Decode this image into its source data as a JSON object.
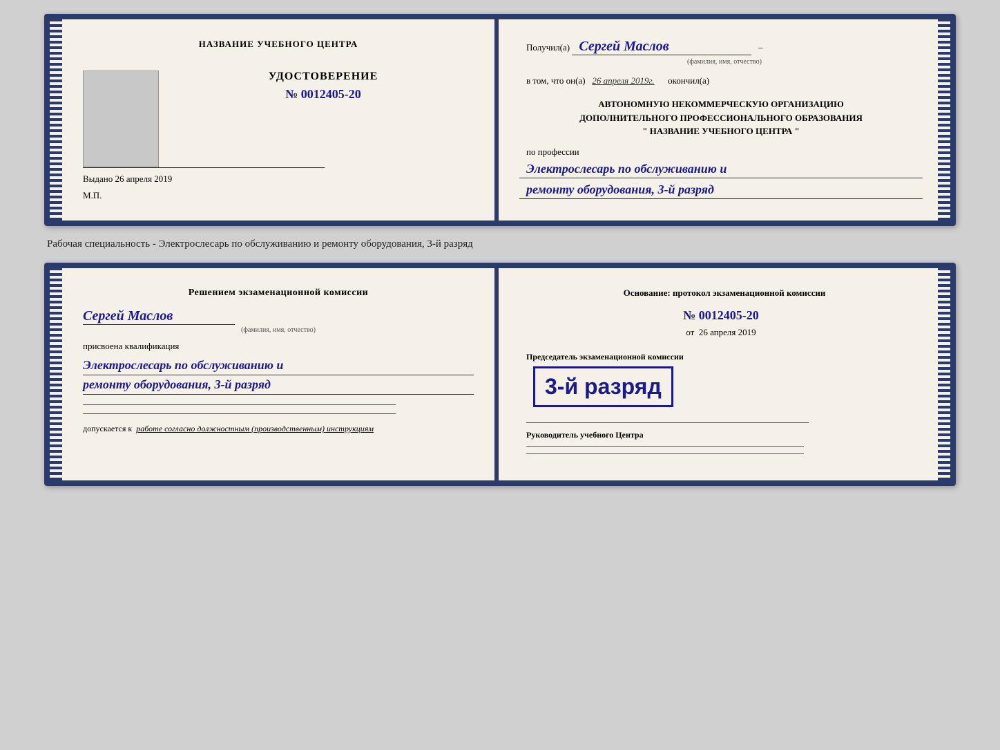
{
  "top_cert": {
    "left": {
      "heading": "НАЗВАНИЕ УЧЕБНОГО ЦЕНТРА",
      "doc_title": "УДОСТОВЕРЕНИЕ",
      "doc_number": "№ 0012405-20",
      "issued_label": "Выдано",
      "issued_date": "26 апреля 2019",
      "mp_label": "М.П."
    },
    "right": {
      "recipient_prefix": "Получил(а)",
      "recipient_name": "Сергей Маслов",
      "fio_label": "(фамилия, имя, отчество)",
      "completed_prefix": "в том, что он(а)",
      "completed_date": "26 апреля 2019г.",
      "completed_suffix": "окончил(а)",
      "org_line1": "АВТОНОМНУЮ НЕКОММЕРЧЕСКУЮ ОРГАНИЗАЦИЮ",
      "org_line2": "ДОПОЛНИТЕЛЬНОГО ПРОФЕССИОНАЛЬНОГО ОБРАЗОВАНИЯ",
      "org_line3": "\" НАЗВАНИЕ УЧЕБНОГО ЦЕНТРА \"",
      "profession_label": "по профессии",
      "profession_line1": "Электрослесарь по обслуживанию и",
      "profession_line2": "ремонту оборудования, 3-й разряд"
    }
  },
  "between_label": "Рабочая специальность - Электрослесарь по обслуживанию и ремонту оборудования, 3-й разряд",
  "bottom_cert": {
    "left": {
      "decision_title": "Решением экзаменационной комиссии",
      "person_name": "Сергей Маслов",
      "fio_label": "(фамилия, имя, отчество)",
      "qualification_label": "присвоена квалификация",
      "qual_line1": "Электрослесарь по обслуживанию и",
      "qual_line2": "ремонту оборудования, 3-й разряд",
      "allowed_prefix": "допускается к",
      "allowed_text": "работе согласно должностным (производственным) инструкциям"
    },
    "right": {
      "basis_title": "Основание: протокол экзаменационной комиссии",
      "protocol_number": "№ 0012405-20",
      "protocol_date_prefix": "от",
      "protocol_date": "26 апреля 2019",
      "chairman_label": "Председатель экзаменационной комиссии",
      "stamp_text": "3-й разряд",
      "director_label": "Руководитель учебного Центра"
    }
  }
}
